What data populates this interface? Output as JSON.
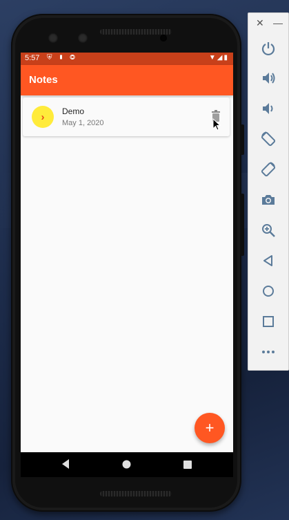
{
  "status_bar": {
    "time": "5:57",
    "left_icons": "⛨ ▮ ◎",
    "right_icons": "▼◢▮"
  },
  "app_bar": {
    "title": "Notes"
  },
  "notes": [
    {
      "avatar_glyph": "›",
      "title": "Demo",
      "date": "May 1, 2020"
    }
  ],
  "fab": {
    "glyph": "+"
  },
  "toolbar": {
    "close_glyph": "✕",
    "minimize_glyph": "—",
    "buttons": [
      "power",
      "volume-up",
      "volume-down",
      "rotate-left",
      "rotate-right",
      "screenshot",
      "zoom",
      "back",
      "home",
      "overview",
      "more"
    ]
  },
  "colors": {
    "primary": "#ff5722",
    "status_bar": "#c8401a",
    "avatar": "#ffeb3b",
    "toolbar_icon": "#5b7b9a"
  }
}
